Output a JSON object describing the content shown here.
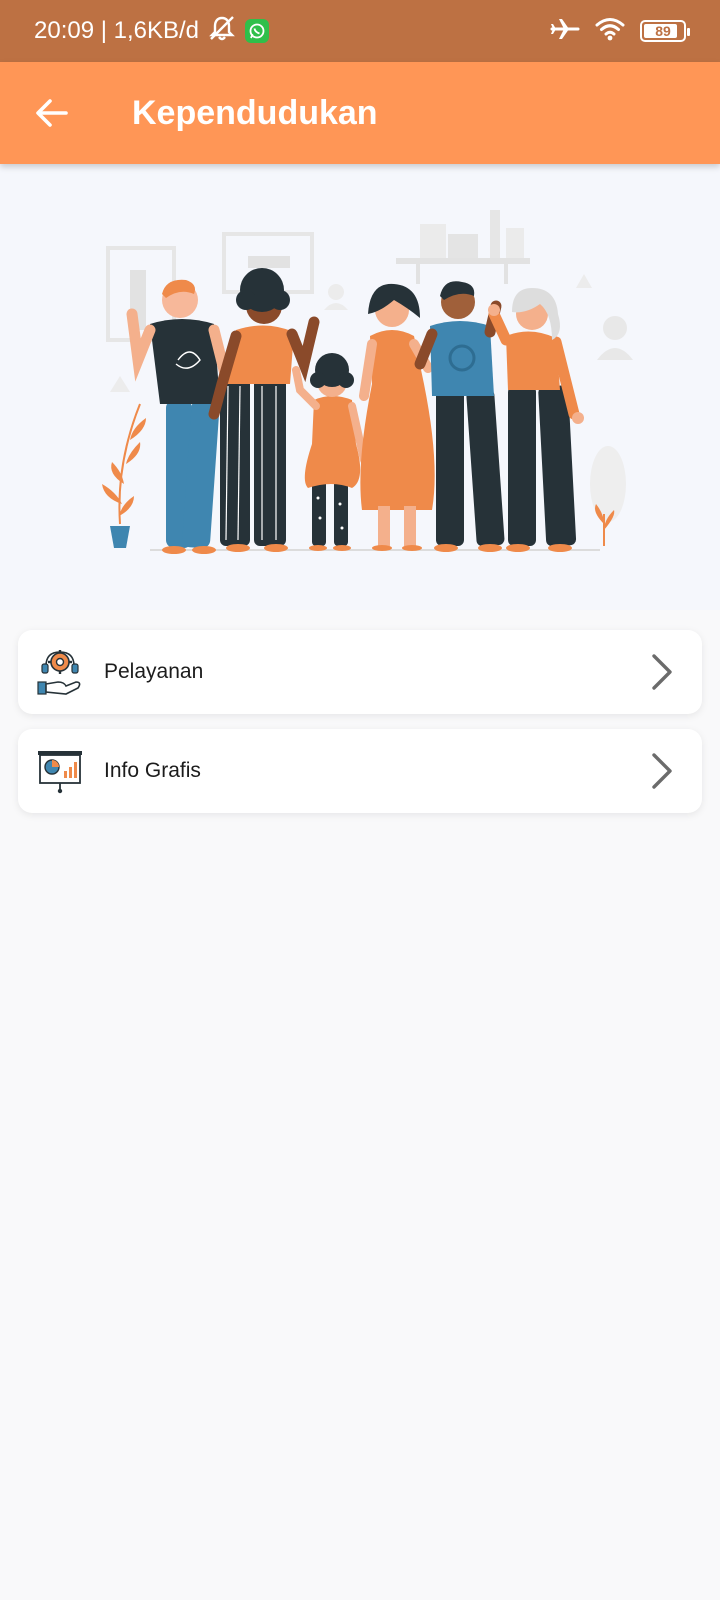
{
  "status_bar": {
    "time_speed": "20:09 | 1,6KB/d",
    "battery": "89",
    "battery_level": 0.89,
    "icons": [
      "mute-icon",
      "whatsapp-icon",
      "airplane-mode-icon",
      "wifi-icon",
      "battery-icon"
    ]
  },
  "app_bar": {
    "title": "Kependudukan",
    "back_icon": "arrow-left-icon",
    "background": "#ff9656"
  },
  "hero": {
    "image": "community-people-illustration"
  },
  "menu": {
    "items": [
      {
        "label": "Pelayanan",
        "icon": "customer-service-gear-icon"
      },
      {
        "label": "Info Grafis",
        "icon": "infographic-presentation-icon"
      }
    ]
  },
  "colors": {
    "status_bar": "#bd7143",
    "accent": "#ff9656",
    "illustration_orange": "#ef8a4a",
    "illustration_blue": "#3f86b0",
    "illustration_dark": "#263238"
  }
}
